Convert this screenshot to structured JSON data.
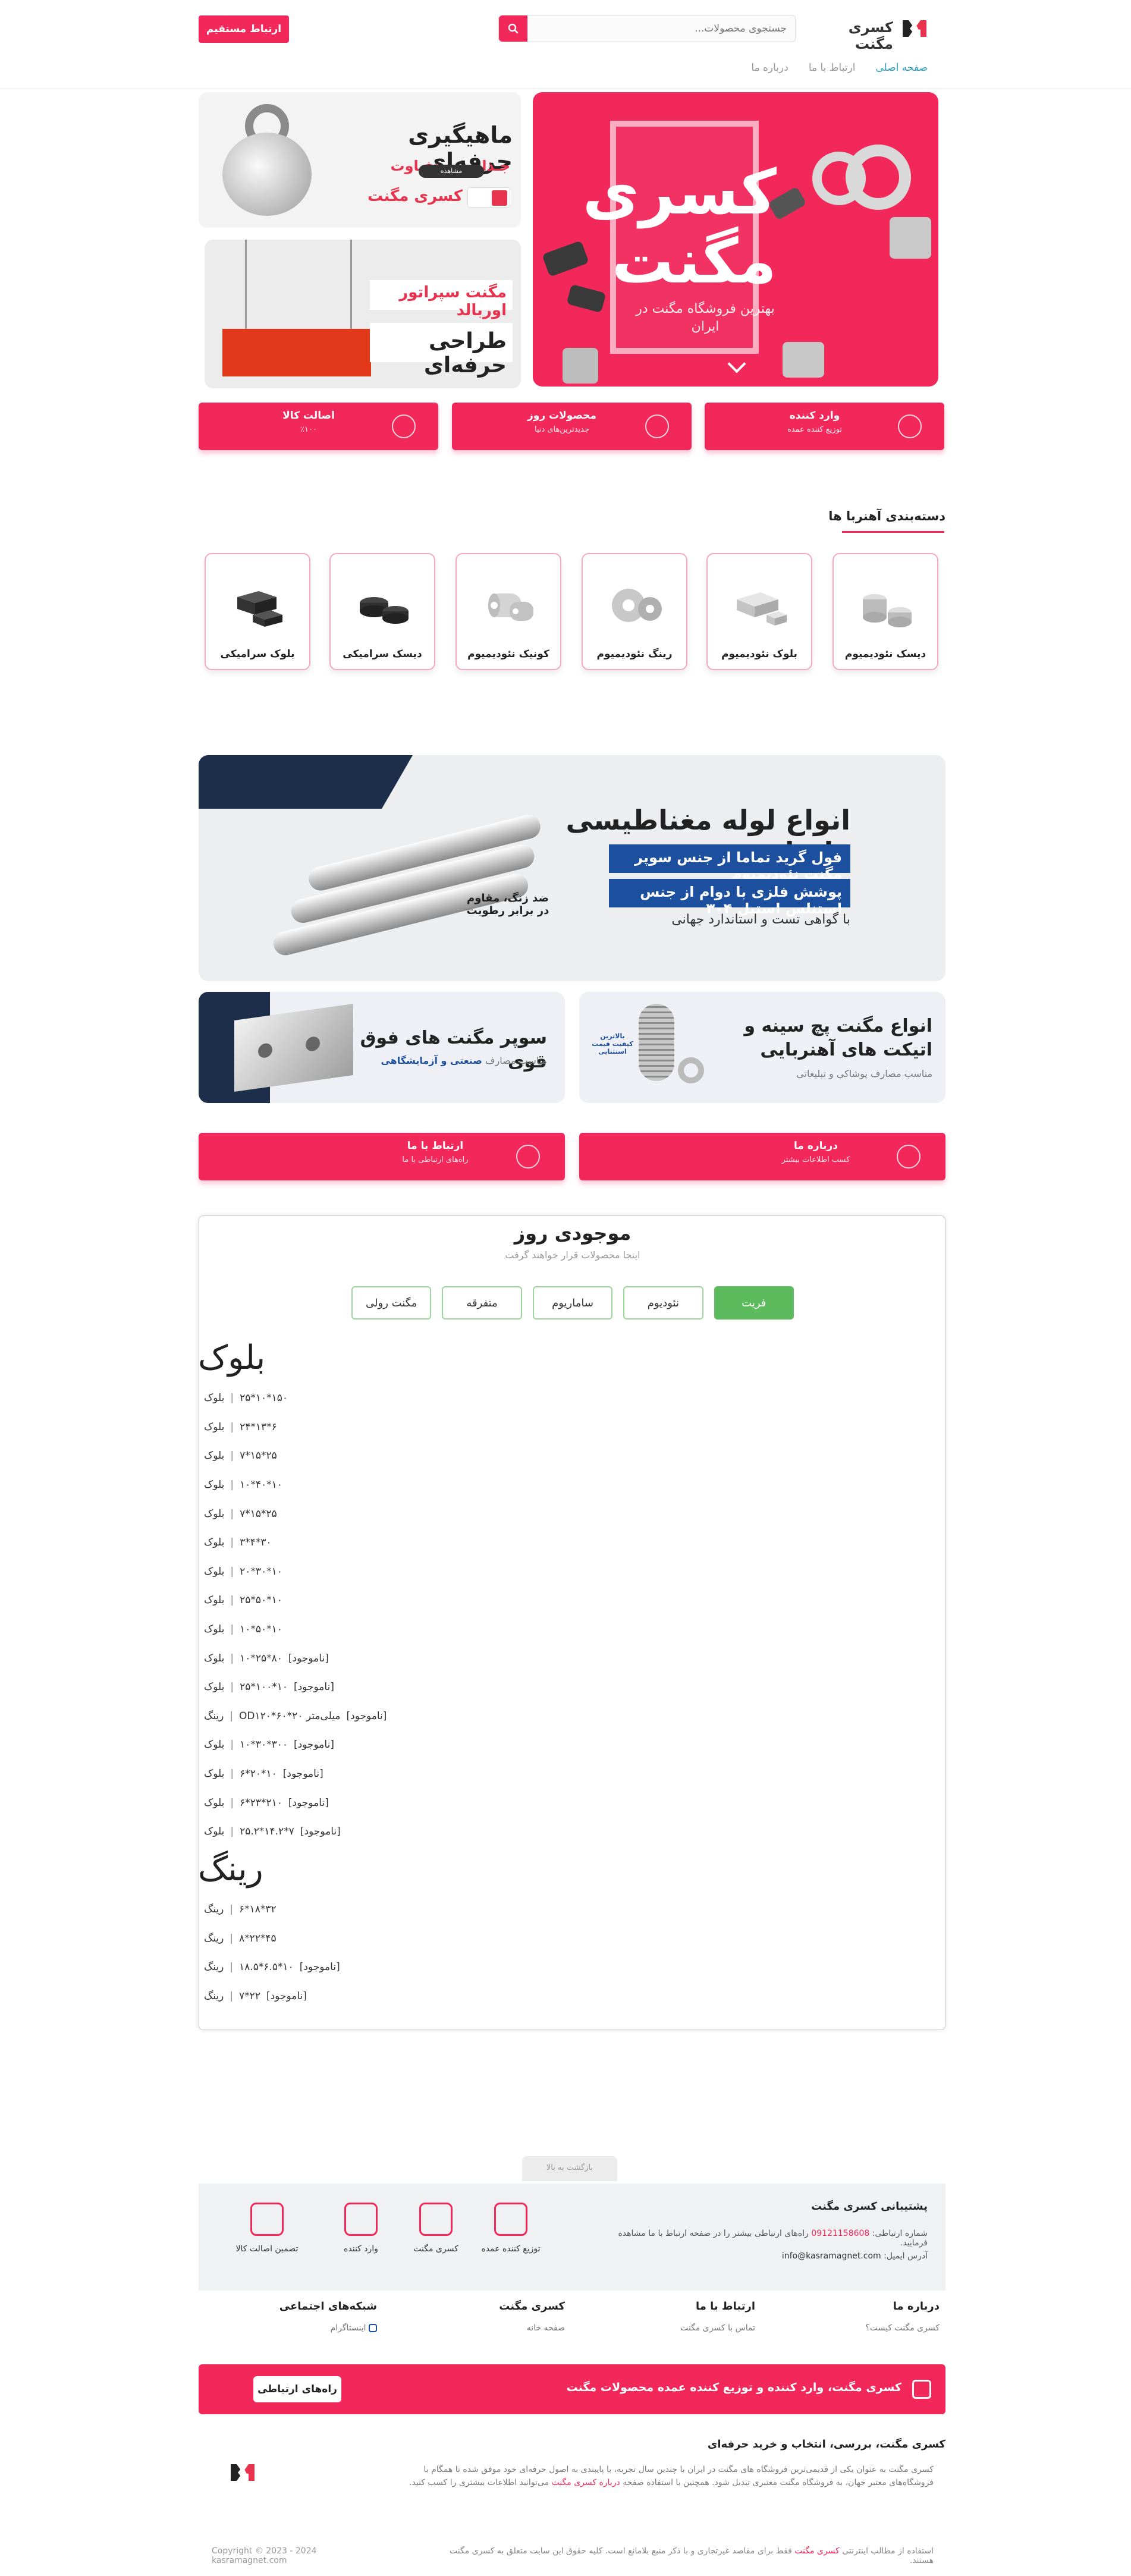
{
  "header": {
    "brand": "کسری مگنت",
    "search_placeholder": "جستجوی محصولات...",
    "contact_button": "ارتباط مستقیم",
    "nav": [
      "صفحه اصلی",
      "ارتباط با ما",
      "درباره ما"
    ]
  },
  "hero": {
    "title_line1": "کسری",
    "title_line2": "مگنت",
    "subtitle": "بهترین فروشگاه مگنت در ایران",
    "fishing": {
      "title": "ماهیگیری حرفه‌ای",
      "subtitle": "جـذاب و متفـاوت",
      "pill": "مشاهده",
      "brand": "کسری مگنت"
    },
    "separator": {
      "label": "مگنت سپراتور اوربالد",
      "title": "طراحی حرفه‌ای"
    }
  },
  "features": [
    {
      "title": "وارد کننده",
      "sub": "توزیع کننده عمده",
      "icon": "shield-icon"
    },
    {
      "title": "محصولات روز",
      "sub": "جدیدترین‌های دنیا",
      "icon": "medal-icon"
    },
    {
      "title": "اصالت کالا",
      "sub": "٪۱۰۰",
      "icon": "truck-icon"
    }
  ],
  "categories": {
    "heading": "دسته‌بندی آهنربا ها",
    "items": [
      {
        "label": "دیسک نئودیمیوم",
        "icon": "disc-neodymium-icon"
      },
      {
        "label": "بلوک نئودیمیوم",
        "icon": "block-neodymium-icon"
      },
      {
        "label": "رینگ نئودیمیوم",
        "icon": "ring-neodymium-icon"
      },
      {
        "label": "کونیک نئودیمیوم",
        "icon": "countersunk-neodymium-icon"
      },
      {
        "label": "دیسک سرامیکی",
        "icon": "disc-ceramic-icon"
      },
      {
        "label": "بلوک سرامیکی",
        "icon": "block-ceramic-icon"
      }
    ]
  },
  "tube_banner": {
    "title": "انواع لوله مغناطیسی وارداتی",
    "bar1": "فول گرید تماما از جنس سوپر مگنت نئودیمیوم",
    "bar2": "پوشش فلزی با دوام از جنس استنلس استیل ۳۰۴",
    "note": "با گواهی تست و استاندارد جهانی",
    "label_line1": "ضد زنگ، مقاوم",
    "label_line2": "در برابر رطوبت"
  },
  "mini_banners": [
    {
      "title_line1": "انواع مگنت پچ سینه و",
      "title_line2": "اتیکت های آهنربایی",
      "sub": "مناسب مصارف پوشاکی و تبلیغاتی",
      "badge": "بالاترین کیفیت قیمت استثنایی"
    },
    {
      "title": "سوپر مگنت های فوق قوی",
      "sub_prefix": "مناسب مصارف",
      "sub_bold": "صنعتی و آزمایشگاهی"
    }
  ],
  "info_cards": [
    {
      "title": "درباره ما",
      "sub": "کسب اطلاعات بیشتر",
      "icon": "shield-icon"
    },
    {
      "title": "ارتباط با ما",
      "sub": "راه‌های ارتباطی با ما",
      "icon": "shield-icon"
    }
  ],
  "stock": {
    "title": "موجودی روز",
    "subtitle": "اینجا محصولات قرار خواهند گرفت",
    "tabs": [
      "فریت",
      "نئودیوم",
      "ساماریوم",
      "متفرقه",
      "مگنت رولی"
    ],
    "active_tab": "فریت",
    "sections": [
      {
        "heading": "بلوک",
        "rows": [
          {
            "name": "بلوک",
            "value": "۲۵*۱۰*۱۵۰",
            "status": ""
          },
          {
            "name": "بلوک",
            "value": "۲۴*۱۳*۶",
            "status": ""
          },
          {
            "name": "بلوک",
            "value": "۷*۱۵*۲۵",
            "status": ""
          },
          {
            "name": "بلوک",
            "value": "۱۰*۴۰*۱۰",
            "status": ""
          },
          {
            "name": "بلوک",
            "value": "۷*۱۵*۲۵",
            "status": ""
          },
          {
            "name": "بلوک",
            "value": "۳*۴*۳۰",
            "status": ""
          },
          {
            "name": "بلوک",
            "value": "۲۰*۳۰*۱۰",
            "status": ""
          },
          {
            "name": "بلوک",
            "value": "۲۵*۵۰*۱۰",
            "status": ""
          },
          {
            "name": "بلوک",
            "value": "۱۰*۵۰*۱۰",
            "status": ""
          },
          {
            "name": "بلوک",
            "value": "۱۰*۲۵*۸۰",
            "status": "[ناموجود]"
          },
          {
            "name": "بلوک",
            "value": "۲۵*۱۰۰*۱۰",
            "status": "[ناموجود]"
          },
          {
            "name": "رینگ",
            "value": "OD۱۲۰*۶۰*۲۰ میلی‌متر",
            "status": "[ناموجود]"
          },
          {
            "name": "بلوک",
            "value": "۱۰*۳۰*۳۰۰",
            "status": "[ناموجود]"
          },
          {
            "name": "بلوک",
            "value": "۶*۲۰*۱۰",
            "status": "[ناموجود]"
          },
          {
            "name": "بلوک",
            "value": "۶*۲۳*۲۱۰",
            "status": "[ناموجود]"
          },
          {
            "name": "بلوک",
            "value": "۲۵.۲*۱۴.۲*۷",
            "status": "[ناموجود]"
          }
        ]
      },
      {
        "heading": "رینگ",
        "rows": [
          {
            "name": "رینگ",
            "value": "۶*۱۸*۳۲",
            "status": ""
          },
          {
            "name": "رینگ",
            "value": "۸*۲۲*۴۵",
            "status": ""
          },
          {
            "name": "رینگ",
            "value": "۱۸.۵*۶.۵*۱۰",
            "status": "[ناموجود]"
          },
          {
            "name": "رینگ",
            "value": "۷*۲۲",
            "status": "[ناموجود]"
          }
        ]
      }
    ]
  },
  "footer": {
    "back_to_top": "بازگشت به بالا",
    "support_title": "پشتیبانی کسری مگنت",
    "phone_label": "شماره ارتباطی:",
    "phone": "09121158608",
    "phone_note": "راه‌های ارتباطی بیشتر را در صفحه ارتباط با ما مشاهده فرمایید.",
    "email_label": "آدرس ایمیل:",
    "email": "info@kasramagnet.com",
    "badges": [
      {
        "label": "توزیع کننده عمده",
        "icon": "truck-icon"
      },
      {
        "label": "کسری مگنت",
        "icon": "shield-check-icon"
      },
      {
        "label": "وارد کننده",
        "icon": "phone-icon"
      },
      {
        "label": "تضمین اصالت کالا",
        "icon": "id-card-icon"
      }
    ],
    "columns": [
      {
        "heading": "درباره ما",
        "link": "کسری مگنت کیست؟"
      },
      {
        "heading": "ارتباط با ما",
        "link": "تماس با کسری مگنت"
      },
      {
        "heading": "کسری مگنت",
        "link": "صفحه خانه"
      },
      {
        "heading": "شبکه‌های اجتماعی",
        "link": "اینستاگرام"
      }
    ],
    "cta_text": "کسری مگنت، وارد کننده و توزیع کننده عمده محصولات مگنت",
    "cta_button": "راه‌های ارتباطی",
    "about_title": "کسری مگنت، بررسی، انتخاب و خرید حرفه‌ای",
    "about_text_1": "کسری مگنت به عنوان یکی از قدیمی‌ترین فروشگاه های مگنت در ایران با چندین سال تجربه، با پایبندی به اصول حرفه‌ای خود موفق شده تا همگام با فروشگاه‌های معتبر جهان، به فروشگاه مگنت معتبری تبدیل شود. همچنین با استفاده صفحه",
    "about_link": "درباره کسری مگنت",
    "about_text_2": "می‌توانید اطلاعات بیشتری را کسب کنید.",
    "copyright_right_1": "استفاده از مطالب اینترنتی",
    "copyright_right_brand": "کسری مگنت",
    "copyright_right_2": "فقط برای مقاصد غیرتجاری و با ذکر منبع بلامانع است. کلیه حقوق این سایت متعلق به کسری مگنت هستند.",
    "copyright_left": "Copyright © 2023 - 2024 kasramagnet.com"
  }
}
